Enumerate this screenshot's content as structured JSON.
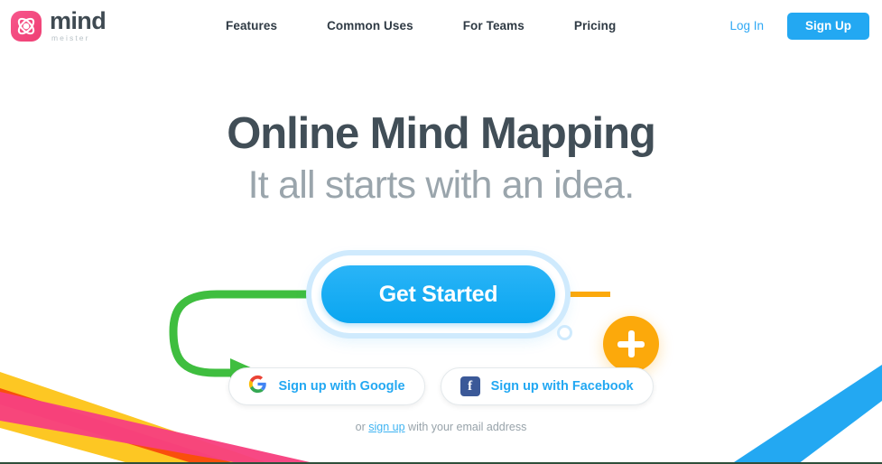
{
  "header": {
    "logo": {
      "icon": "mindmeister-atom-icon",
      "word": "mind",
      "sub": "meister"
    },
    "nav": [
      {
        "label": "Features"
      },
      {
        "label": "Common Uses"
      },
      {
        "label": "For Teams"
      },
      {
        "label": "Pricing"
      }
    ],
    "login_label": "Log In",
    "signup_label": "Sign Up"
  },
  "hero": {
    "headline": "Online Mind Mapping",
    "subhead": "It all starts with an idea.",
    "cta_label": "Get Started",
    "plus_node_icon": "plus-icon",
    "social": [
      {
        "icon": "google-g-icon",
        "label": "Sign up with Google"
      },
      {
        "icon": "facebook-f-icon",
        "label": "Sign up with Facebook",
        "mark": "f"
      }
    ],
    "email": {
      "prefix": "or ",
      "link": "sign up",
      "suffix": " with your email address"
    }
  },
  "colors": {
    "brand_pink": "#f24b82",
    "accent_blue": "#23a8f2",
    "halo_blue": "#cfeafd",
    "green_arrow": "#3fbe3f",
    "orange_node": "#fca90b",
    "headline_slate": "#414e57",
    "subhead_gray": "#9aa5ac",
    "ribbon_pink": "#f7417f",
    "ribbon_yellow": "#fdc723",
    "ribbon_orange": "#f94f0c",
    "ribbon_blue": "#23a8f2"
  }
}
